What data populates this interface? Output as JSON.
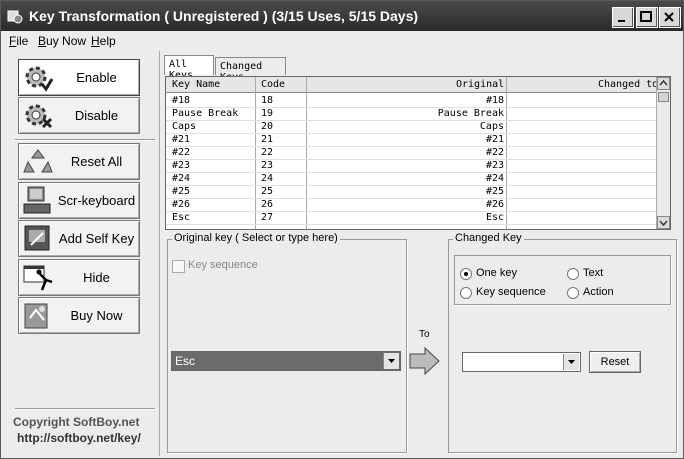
{
  "window": {
    "title": "Key Transformation ( Unregistered ) (3/15 Uses, 5/15 Days)",
    "buttons": [
      "minimize-icon",
      "maximize-icon",
      "close-icon"
    ]
  },
  "menu": [
    "File",
    "Buy Now",
    "Help"
  ],
  "sidebar": {
    "buttons": [
      {
        "label": "Enable",
        "icon": "enable-gear-icon",
        "active": true
      },
      {
        "label": "Disable",
        "icon": "disable-gear-icon",
        "active": false
      },
      {
        "label": "Reset All",
        "icon": "recycle-icon",
        "active": false
      },
      {
        "label": "Scr-keyboard",
        "icon": "screen-keyboard-icon",
        "active": false
      },
      {
        "label": "Add Self Key",
        "icon": "add-key-icon",
        "active": false
      },
      {
        "label": "Hide",
        "icon": "hide-icon",
        "active": false
      },
      {
        "label": "Buy Now",
        "icon": "buy-icon",
        "active": false
      }
    ],
    "copyright": "Copyright  SoftBoy.net",
    "url": "http://softboy.net/key/"
  },
  "tabs": [
    "All Keys",
    "Changed Keys"
  ],
  "table": {
    "columns": [
      "Key Name",
      "Code",
      "Original",
      "Changed to"
    ],
    "rows": [
      [
        "#18",
        "18",
        "#18",
        ""
      ],
      [
        "Pause Break",
        "19",
        "Pause Break",
        ""
      ],
      [
        "Caps",
        "20",
        "Caps",
        ""
      ],
      [
        "#21",
        "21",
        "#21",
        ""
      ],
      [
        "#22",
        "22",
        "#22",
        ""
      ],
      [
        "#23",
        "23",
        "#23",
        ""
      ],
      [
        "#24",
        "24",
        "#24",
        ""
      ],
      [
        "#25",
        "25",
        "#25",
        ""
      ],
      [
        "#26",
        "26",
        "#26",
        ""
      ],
      [
        "Esc",
        "27",
        "Esc",
        ""
      ]
    ]
  },
  "original_key": {
    "legend": "Original key ( Select or type here)",
    "key_sequence_label": "Key sequence",
    "key_sequence_checked": false,
    "selected": "Esc"
  },
  "to_label": "To",
  "changed_key": {
    "legend": "Changed Key",
    "options": [
      {
        "label": "One key",
        "selected": true
      },
      {
        "label": "Text",
        "selected": false
      },
      {
        "label": "Key sequence",
        "selected": false
      },
      {
        "label": "Action",
        "selected": false
      }
    ],
    "selected": "",
    "reset_label": "Reset"
  },
  "colors": {
    "selection": "#6b6b6b",
    "titlebar": "#333333"
  }
}
